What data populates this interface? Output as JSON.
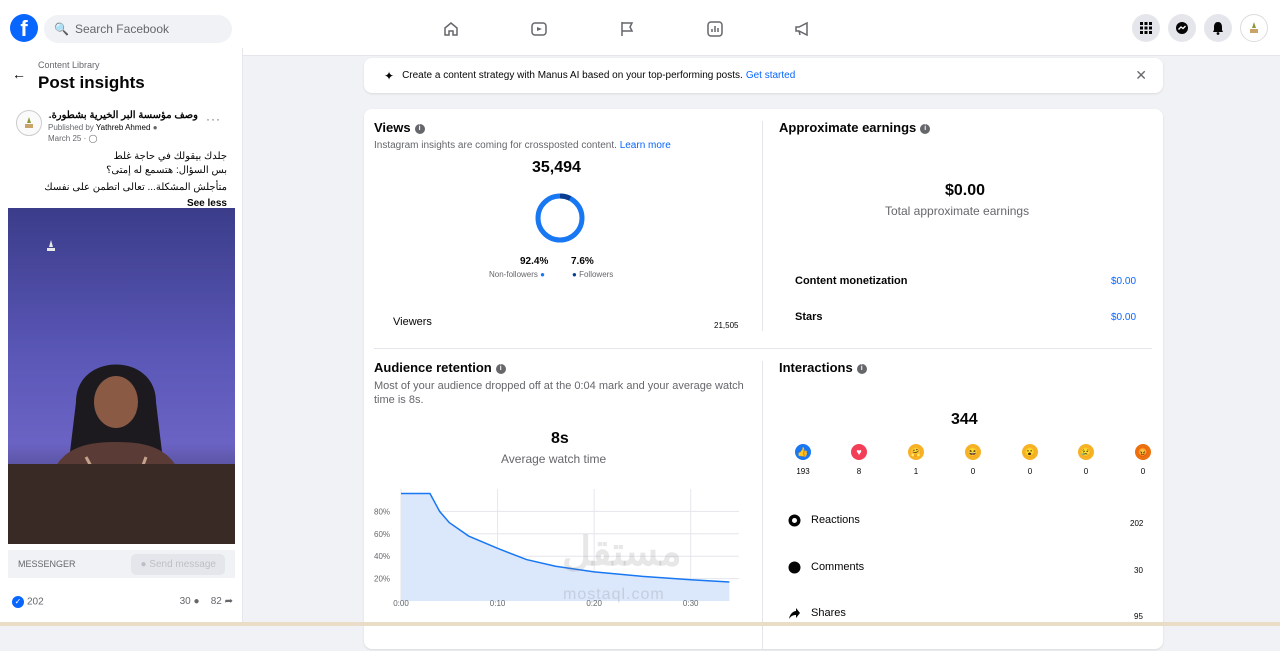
{
  "topbar": {
    "search_placeholder": "Search Facebook",
    "nav_icons": [
      "home-icon",
      "video-icon",
      "flag-icon",
      "chart-icon",
      "megaphone-icon"
    ],
    "right_icons": [
      "apps-grid-icon",
      "messenger-icon",
      "bell-icon",
      "profile-avatar"
    ]
  },
  "left": {
    "breadcrumb": "Content Library",
    "title": "Post insights",
    "post": {
      "page_name": "وصف مؤسسة البر الخيرية بشطورة...",
      "published_prefix": "Published by",
      "author": "Yathreb Ahmed",
      "date": "March 25 ·",
      "line1": "جلدك بيقولك في حاجة غلط",
      "line2": "بس السؤال: هتسمع له إمتى؟",
      "line3": "متأجلش المشكلة... تعالى اتطمن على نفسك",
      "see_less": "See less"
    },
    "messenger_label": "MESSENGER",
    "send_label": "Send message",
    "likes": "202",
    "comments": "30",
    "shares": "82"
  },
  "banner": {
    "text": "Create a content strategy with Manus AI based on your top-performing posts.",
    "link": "Get started"
  },
  "views": {
    "title": "Views",
    "subtitle": "Instagram insights are coming for crossposted content.",
    "learn_more": "Learn more",
    "total": "35,494",
    "non_followers_pct": "92.4%",
    "followers_pct": "7.6%",
    "non_followers_label": "Non-followers",
    "followers_label": "Followers",
    "non_followers_fraction": 0.924,
    "viewers_label": "Viewers",
    "viewers_value": "21,505"
  },
  "earnings": {
    "title": "Approximate earnings",
    "total": "$0.00",
    "total_label": "Total approximate earnings",
    "rows": [
      {
        "label": "Content monetization",
        "value": "$0.00"
      },
      {
        "label": "Stars",
        "value": "$0.00"
      }
    ]
  },
  "retention": {
    "title": "Audience retention",
    "desc": "Most of your audience dropped off at the 0:04 mark and your average watch time is 8s.",
    "avg": "8s",
    "avg_label": "Average watch time"
  },
  "chart_data": {
    "type": "area",
    "x": [
      0,
      0.03,
      0.04,
      0.05,
      0.07,
      0.1,
      0.13,
      0.16,
      0.2,
      0.25,
      0.3,
      0.34
    ],
    "values": [
      96,
      96,
      80,
      70,
      58,
      47,
      37,
      31,
      26,
      22,
      19,
      17
    ],
    "x_ticks": [
      "0:00",
      "0:10",
      "0:20",
      "0:30"
    ],
    "y_ticks": [
      "20%",
      "40%",
      "60%",
      "80%"
    ],
    "ylim": [
      0,
      100
    ]
  },
  "interactions": {
    "title": "Interactions",
    "total": "344",
    "reactions": [
      {
        "icon": "like-icon",
        "count": "193",
        "color": "#1877f2",
        "glyph": "👍"
      },
      {
        "icon": "love-icon",
        "count": "8",
        "color": "#f33e58",
        "glyph": "♥"
      },
      {
        "icon": "care-icon",
        "count": "1",
        "color": "#f7b125",
        "glyph": "🤗"
      },
      {
        "icon": "haha-icon",
        "count": "0",
        "color": "#f7b125",
        "glyph": "😆"
      },
      {
        "icon": "wow-icon",
        "count": "0",
        "color": "#f7b125",
        "glyph": "😮"
      },
      {
        "icon": "sad-icon",
        "count": "0",
        "color": "#f7b125",
        "glyph": "😢"
      },
      {
        "icon": "angry-icon",
        "count": "0",
        "color": "#e9710f",
        "glyph": "😡"
      }
    ],
    "rows": [
      {
        "label": "Reactions",
        "value": "202"
      },
      {
        "label": "Comments",
        "value": "30"
      },
      {
        "label": "Shares",
        "value": "95"
      }
    ]
  },
  "watermark": "mostaql.com"
}
